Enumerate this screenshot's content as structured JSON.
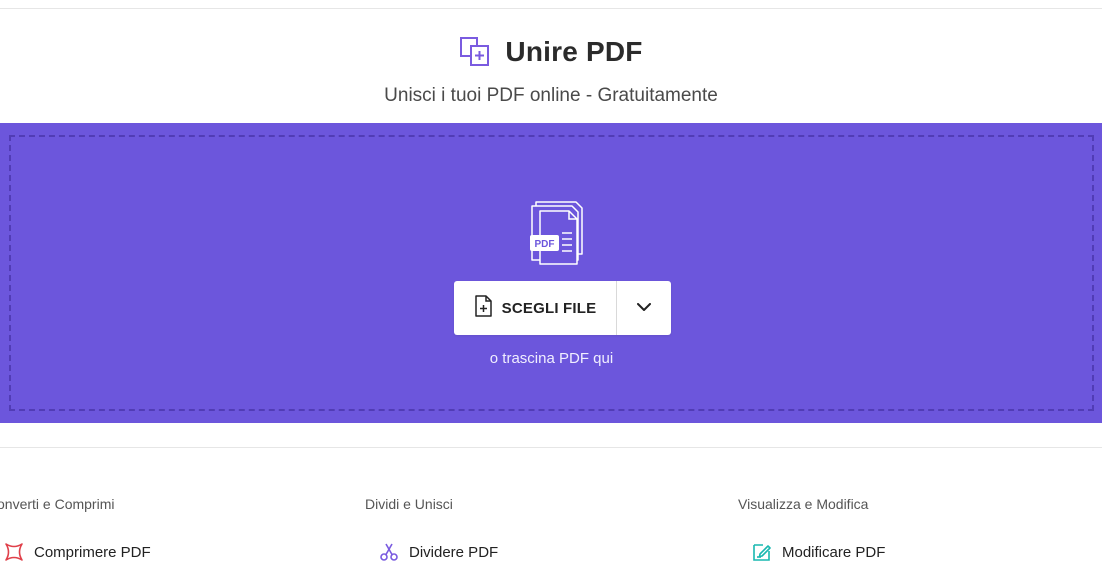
{
  "header": {
    "title": "Unire PDF",
    "subtitle": "Unisci i tuoi PDF online - Gratuitamente",
    "icon": "merge-pdf-icon"
  },
  "dropzone": {
    "graphic_label": "PDF",
    "choose_label": "SCEGLI FILE",
    "drag_hint": "o trascina PDF qui",
    "background_color": "#6c56dc"
  },
  "tools": {
    "columns": [
      {
        "title": "onverti e Comprimi",
        "item": {
          "label": "Comprimere PDF",
          "icon": "compress-icon",
          "color": "#e0404a"
        }
      },
      {
        "title": "Dividi e Unisci",
        "item": {
          "label": "Dividere PDF",
          "icon": "scissors-icon",
          "color": "#7a5be0"
        }
      },
      {
        "title": "Visualizza e Modifica",
        "item": {
          "label": "Modificare PDF",
          "icon": "edit-icon",
          "color": "#18b8b0"
        }
      }
    ]
  }
}
